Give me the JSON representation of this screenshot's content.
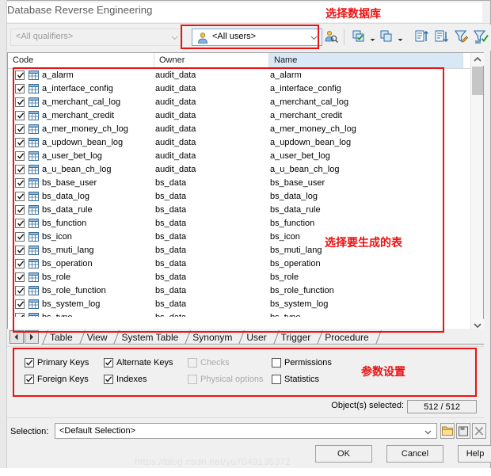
{
  "window": {
    "title": "Database Reverse Engineering"
  },
  "toolbar": {
    "qualifier_combo": {
      "value": "<All qualifiers>",
      "icon": "chevron-down-icon",
      "enabled": false
    },
    "user_combo": {
      "value": "<All users>",
      "icon": "user-icon",
      "chevron": "chevron-down-icon"
    },
    "buttons": [
      {
        "name": "user-filter-icon",
        "glyph": "user-search"
      },
      {
        "name": "select-all-icon",
        "glyph": "select-all"
      },
      {
        "name": "deselect-all-icon",
        "glyph": "deselect-all"
      },
      {
        "name": "sort-ascending-icon",
        "glyph": "sort-asc"
      },
      {
        "name": "sort-descending-icon",
        "glyph": "sort-desc"
      },
      {
        "name": "edit-filter-icon",
        "glyph": "filter-edit"
      },
      {
        "name": "apply-filter-icon",
        "glyph": "filter-apply"
      }
    ]
  },
  "annotations": {
    "select_database": "选择数据库",
    "select_tables": "选择要生成的表",
    "parameter_settings": "参数设置",
    "color": "#ee1111"
  },
  "list": {
    "columns": [
      "Code",
      "Owner",
      "Name"
    ],
    "highlighted_column": "Name",
    "rows": [
      {
        "checked": true,
        "code": "a_alarm",
        "owner": "audit_data",
        "name": "a_alarm"
      },
      {
        "checked": true,
        "code": "a_interface_config",
        "owner": "audit_data",
        "name": "a_interface_config"
      },
      {
        "checked": true,
        "code": "a_merchant_cal_log",
        "owner": "audit_data",
        "name": "a_merchant_cal_log"
      },
      {
        "checked": true,
        "code": "a_merchant_credit",
        "owner": "audit_data",
        "name": "a_merchant_credit"
      },
      {
        "checked": true,
        "code": "a_mer_money_ch_log",
        "owner": "audit_data",
        "name": "a_mer_money_ch_log"
      },
      {
        "checked": true,
        "code": "a_updown_bean_log",
        "owner": "audit_data",
        "name": "a_updown_bean_log"
      },
      {
        "checked": true,
        "code": "a_user_bet_log",
        "owner": "audit_data",
        "name": "a_user_bet_log"
      },
      {
        "checked": true,
        "code": "a_u_bean_ch_log",
        "owner": "audit_data",
        "name": "a_u_bean_ch_log"
      },
      {
        "checked": true,
        "code": "bs_base_user",
        "owner": "bs_data",
        "name": "bs_base_user"
      },
      {
        "checked": true,
        "code": "bs_data_log",
        "owner": "bs_data",
        "name": "bs_data_log"
      },
      {
        "checked": true,
        "code": "bs_data_rule",
        "owner": "bs_data",
        "name": "bs_data_rule"
      },
      {
        "checked": true,
        "code": "bs_function",
        "owner": "bs_data",
        "name": "bs_function"
      },
      {
        "checked": true,
        "code": "bs_icon",
        "owner": "bs_data",
        "name": "bs_icon"
      },
      {
        "checked": true,
        "code": "bs_muti_lang",
        "owner": "bs_data",
        "name": "bs_muti_lang"
      },
      {
        "checked": true,
        "code": "bs_operation",
        "owner": "bs_data",
        "name": "bs_operation"
      },
      {
        "checked": true,
        "code": "bs_role",
        "owner": "bs_data",
        "name": "bs_role"
      },
      {
        "checked": true,
        "code": "bs_role_function",
        "owner": "bs_data",
        "name": "bs_role_function"
      },
      {
        "checked": true,
        "code": "bs_system_log",
        "owner": "bs_data",
        "name": "bs_system_log"
      },
      {
        "checked": true,
        "code": "bs_type",
        "owner": "bs_data",
        "name": "bs_type"
      }
    ],
    "scrollbar": {
      "up_arrow": "chevron-up-icon",
      "down_arrow": "chevron-down-icon"
    }
  },
  "tabs": {
    "prev_label": "◀",
    "next_label": "▶",
    "items": [
      {
        "label": "Table",
        "active": true
      },
      {
        "label": "View",
        "active": false
      },
      {
        "label": "System Table",
        "active": false
      },
      {
        "label": "Synonym",
        "active": false
      },
      {
        "label": "User",
        "active": false
      },
      {
        "label": "Trigger",
        "active": false
      },
      {
        "label": "Procedure",
        "active": false
      }
    ]
  },
  "options": [
    {
      "label": "Primary Keys",
      "checked": true,
      "enabled": true
    },
    {
      "label": "Alternate Keys",
      "checked": true,
      "enabled": true
    },
    {
      "label": "Checks",
      "checked": false,
      "enabled": false
    },
    {
      "label": "Permissions",
      "checked": false,
      "enabled": true
    },
    {
      "label": "Foreign Keys",
      "checked": true,
      "enabled": true
    },
    {
      "label": "Indexes",
      "checked": true,
      "enabled": true
    },
    {
      "label": "Physical options",
      "checked": false,
      "enabled": false
    },
    {
      "label": "Statistics",
      "checked": false,
      "enabled": true
    }
  ],
  "status": {
    "objects_selected_label": "Object(s) selected:",
    "objects_selected_value": "512 / 512"
  },
  "selection": {
    "label": "Selection:",
    "value": "<Default Selection>",
    "buttons": [
      {
        "name": "open-folder-icon"
      },
      {
        "name": "save-icon"
      },
      {
        "name": "delete-icon"
      }
    ]
  },
  "buttons": {
    "ok": "OK",
    "cancel": "Cancel",
    "help": "Help"
  },
  "watermark": "https://blog.csdn.net/yu7049135372"
}
